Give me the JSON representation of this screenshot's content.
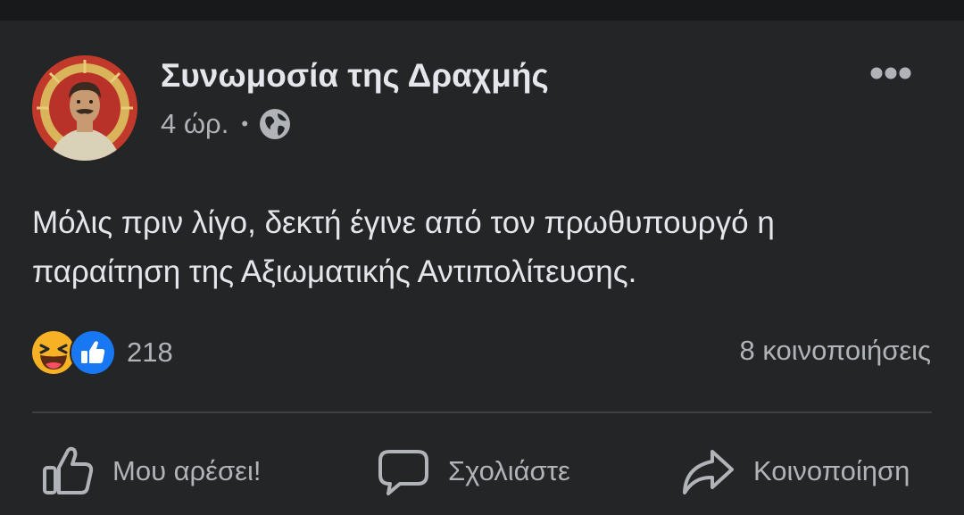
{
  "post": {
    "page_name": "Συνωμοσία της Δραχμής",
    "time": "4 ώρ.",
    "separator": "•",
    "privacy_icon": "globe-icon",
    "more_icon": "more-options-icon",
    "text_line1": "Μόλις πριν λίγο, δεκτή έγινε από τον πρωθυπουργό η",
    "text_line2": "παραίτηση της Αξιωματικής Αντιπολίτευσης."
  },
  "stats": {
    "reaction_icons": [
      "haha-reaction-icon",
      "like-reaction-icon"
    ],
    "reaction_count": "218",
    "shares": "8 κοινοποιήσεις"
  },
  "actions": {
    "like_label": "Μου αρέσει!",
    "comment_label": "Σχολιάστε",
    "share_label": "Κοινοποίηση"
  },
  "colors": {
    "background": "#242526",
    "text_primary": "#e4e6eb",
    "text_secondary": "#b0b3b8",
    "like_blue": "#1877f2",
    "haha_yellow": "#f7b125"
  }
}
